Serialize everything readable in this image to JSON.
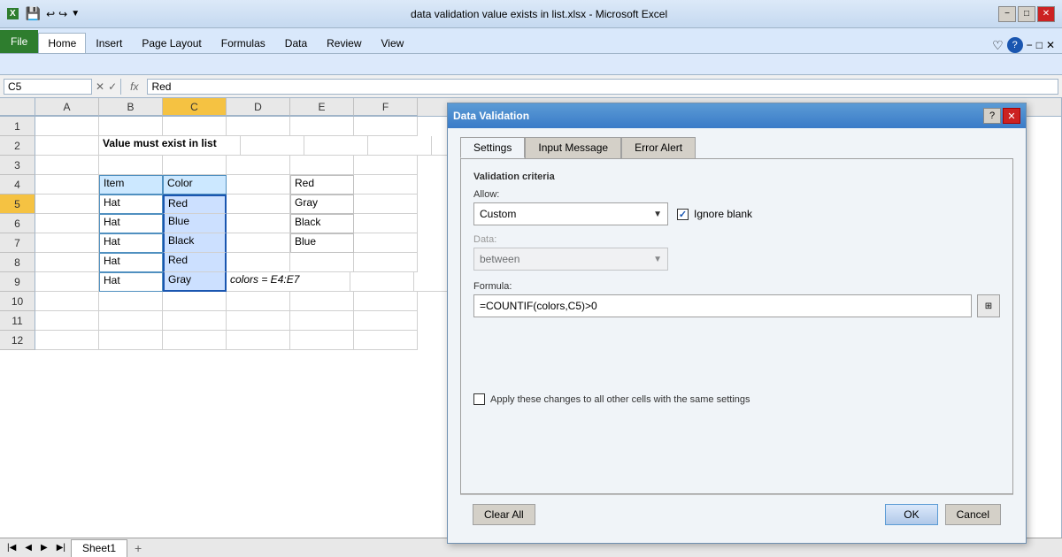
{
  "titlebar": {
    "title": "data validation value exists in list.xlsx - Microsoft Excel",
    "minimize": "−",
    "maximize": "□",
    "close": "✕"
  },
  "ribbon": {
    "tabs": [
      "Home",
      "Insert",
      "Page Layout",
      "Formulas",
      "Data",
      "Review",
      "View"
    ]
  },
  "formulabar": {
    "namebox": "C5",
    "formula": "Red"
  },
  "columns": [
    "A",
    "B",
    "C",
    "D",
    "E",
    "F"
  ],
  "rows": [
    "1",
    "2",
    "3",
    "4",
    "5",
    "6",
    "7",
    "8",
    "9",
    "10",
    "11",
    "12"
  ],
  "cells": {
    "B2": "Value must exist in list",
    "B4": "Item",
    "C4": "Color",
    "B5": "Hat",
    "C5": "Red",
    "B6": "Hat",
    "C6": "Blue",
    "B7": "Hat",
    "C7": "Black",
    "B8": "Hat",
    "C8": "Red",
    "B9": "Hat",
    "C9": "Gray",
    "E4": "Red",
    "E5": "Gray",
    "E6": "Black",
    "E7": "Blue",
    "D9": "colors = E4:E7"
  },
  "dialog": {
    "title": "Data Validation",
    "tabs": [
      "Settings",
      "Input Message",
      "Error Alert"
    ],
    "active_tab": "Settings",
    "section": "Validation criteria",
    "allow_label": "Allow:",
    "allow_value": "Custom",
    "ignore_blank": true,
    "ignore_blank_label": "Ignore blank",
    "data_label": "Data:",
    "data_value": "between",
    "formula_label": "Formula:",
    "formula_value": "=COUNTIF(colors,C5)>0",
    "apply_label": "Apply these changes to all other cells with the same settings",
    "buttons": {
      "clear_all": "Clear All",
      "ok": "OK",
      "cancel": "Cancel"
    }
  },
  "sheet": {
    "tabs": [
      "Sheet1"
    ]
  }
}
